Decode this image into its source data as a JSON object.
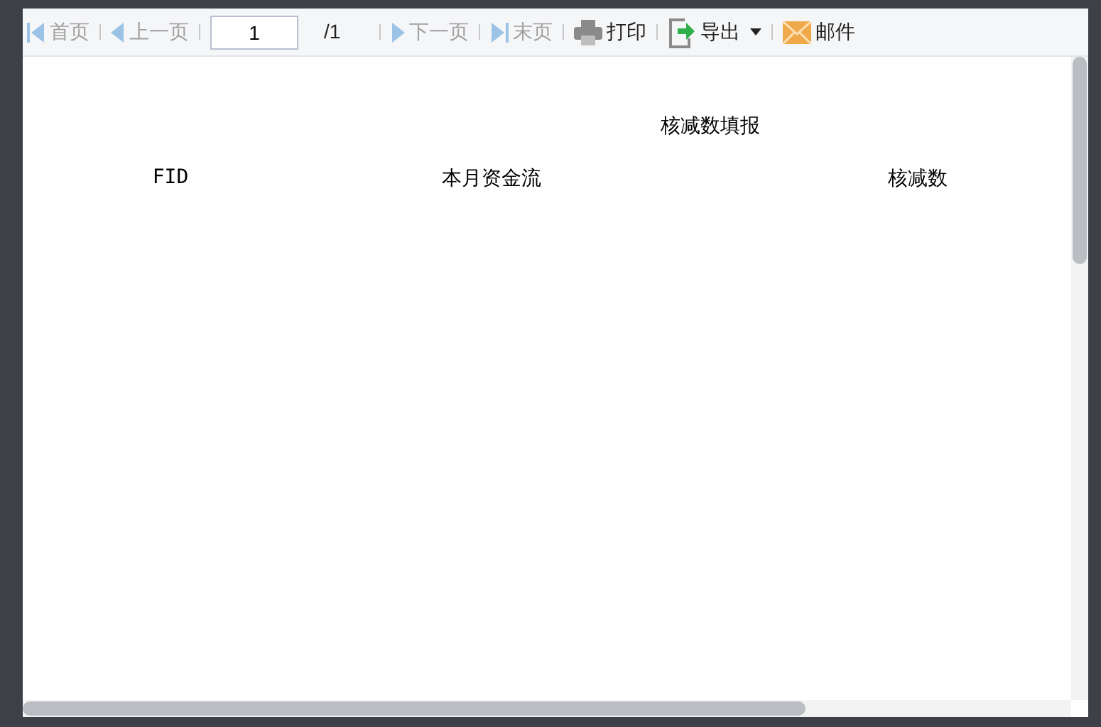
{
  "toolbar": {
    "items": [
      {
        "kind": "first",
        "label": "首页",
        "disabled": true
      },
      {
        "kind": "prev",
        "label": "上一页",
        "disabled": true
      },
      {
        "kind": "page",
        "value": "1",
        "total": "/1"
      },
      {
        "kind": "next",
        "label": "下一页",
        "disabled": true
      },
      {
        "kind": "last",
        "label": "末页",
        "disabled": true
      },
      {
        "kind": "print",
        "label": "打印",
        "disabled": false
      },
      {
        "kind": "export",
        "label": "导出",
        "disabled": false
      },
      {
        "kind": "mail",
        "label": "邮件",
        "disabled": false
      }
    ]
  },
  "report": {
    "title": "核减数填报",
    "columns": [
      "FID",
      "本月资金流",
      "核减数"
    ]
  }
}
